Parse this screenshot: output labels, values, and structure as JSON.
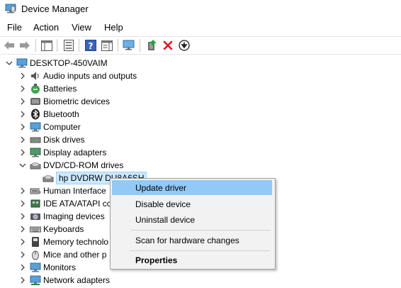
{
  "window": {
    "title": "Device Manager"
  },
  "menu": [
    "File",
    "Action",
    "View",
    "Help"
  ],
  "toolbar": {
    "buttons": [
      "back-arrow",
      "forward-arrow",
      "show-hide-console-tree",
      "properties",
      "help",
      "action-pane",
      "scan-for-hardware",
      "update-driver",
      "uninstall-device",
      "download-driver"
    ]
  },
  "tree": {
    "root": "DESKTOP-450VAIM",
    "items": [
      {
        "label": "Audio inputs and outputs",
        "icon": "speaker-icon",
        "expanded": false
      },
      {
        "label": "Batteries",
        "icon": "battery-icon",
        "expanded": false
      },
      {
        "label": "Biometric devices",
        "icon": "fingerprint-icon",
        "expanded": false
      },
      {
        "label": "Bluetooth",
        "icon": "bluetooth-icon",
        "expanded": false
      },
      {
        "label": "Computer",
        "icon": "monitor-icon",
        "expanded": false
      },
      {
        "label": "Disk drives",
        "icon": "disk-drive-icon",
        "expanded": false
      },
      {
        "label": "Display adapters",
        "icon": "display-adapter-icon",
        "expanded": false
      },
      {
        "label": "DVD/CD-ROM drives",
        "icon": "dvd-drive-icon",
        "expanded": true
      },
      {
        "label": "Human Interface",
        "icon": "hid-icon",
        "expanded": false
      },
      {
        "label": "IDE ATA/ATAPI cc",
        "icon": "ide-controller-icon",
        "expanded": false
      },
      {
        "label": "Imaging devices",
        "icon": "camera-icon",
        "expanded": false
      },
      {
        "label": "Keyboards",
        "icon": "keyboard-icon",
        "expanded": false
      },
      {
        "label": "Memory technolo",
        "icon": "memory-icon",
        "expanded": false
      },
      {
        "label": "Mice and other p",
        "icon": "mouse-icon",
        "expanded": false
      },
      {
        "label": "Monitors",
        "icon": "monitor-icon",
        "expanded": false
      },
      {
        "label": "Network adapters",
        "icon": "network-adapter-icon",
        "expanded": false
      }
    ],
    "dvd_child": "hp DVDRW  DU8A6SH"
  },
  "context_menu": {
    "items": [
      "Update driver",
      "Disable device",
      "Uninstall device",
      "Scan for hardware changes",
      "Properties"
    ],
    "highlighted": "Update driver"
  },
  "colors": {
    "hover_blue": "#91c9f7",
    "selection_blue": "#cce8ff",
    "delete_red": "#e81123"
  }
}
